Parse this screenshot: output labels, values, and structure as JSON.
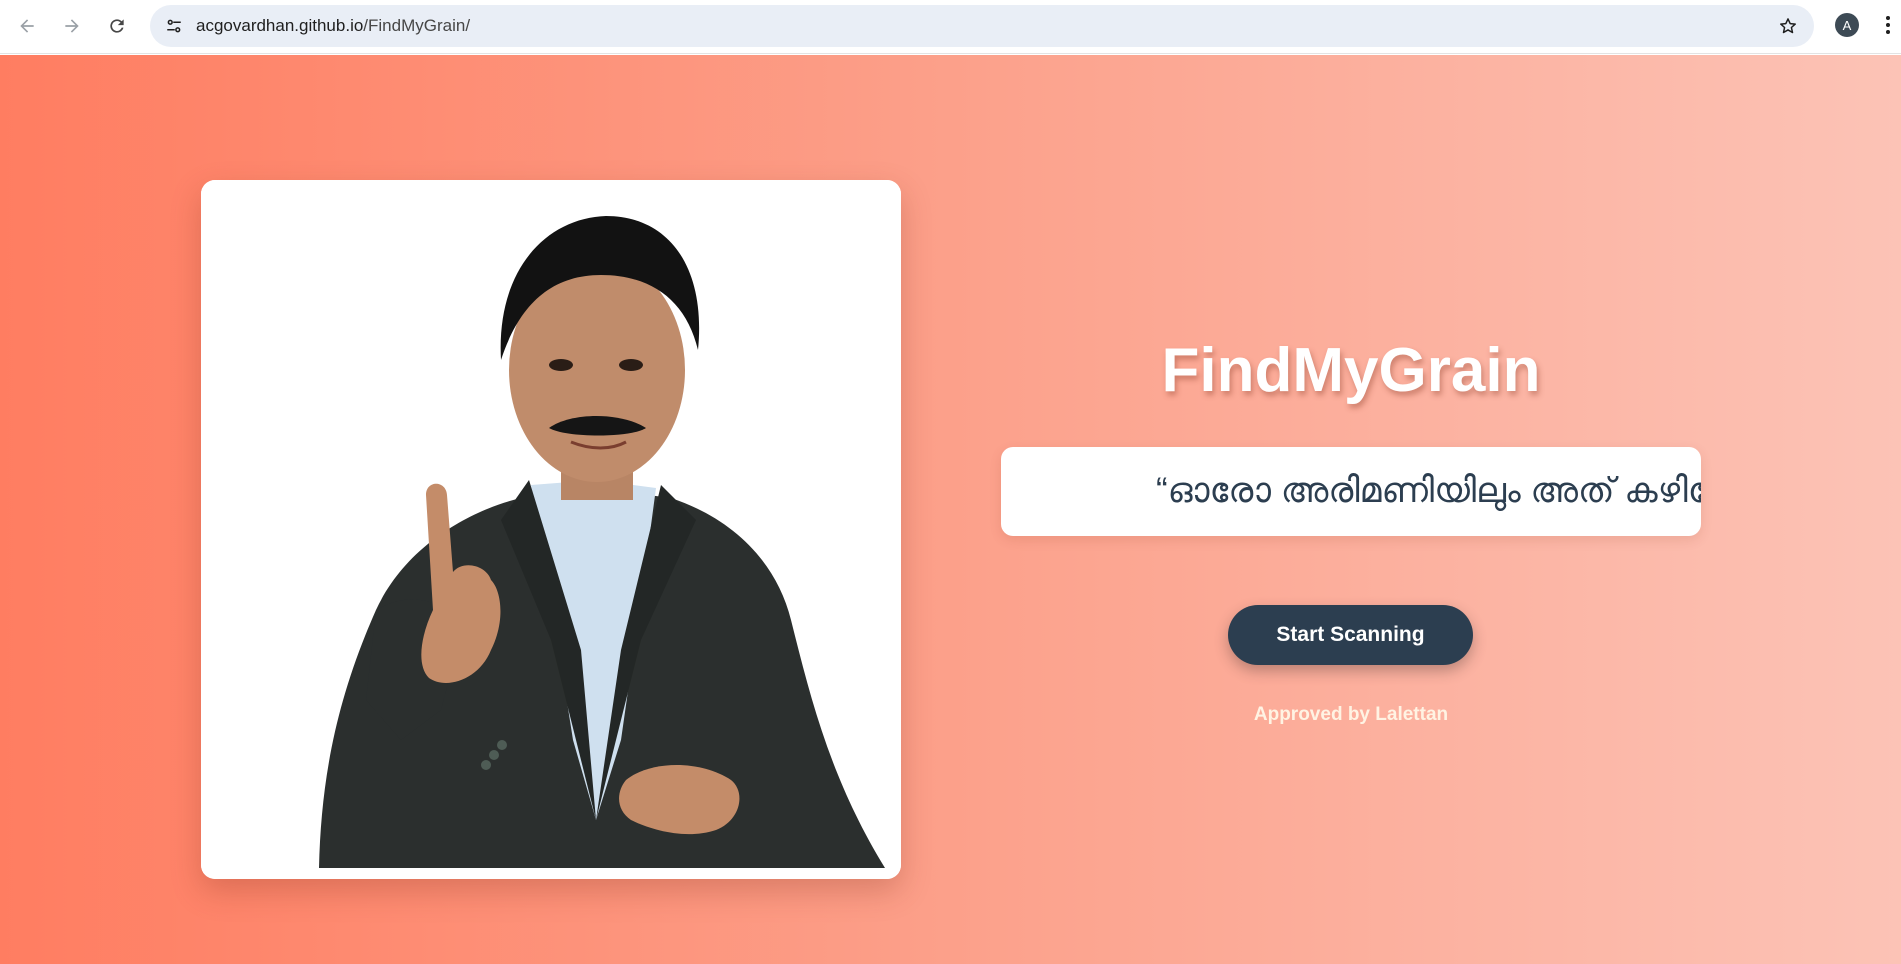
{
  "browser": {
    "url_host": "acgovardhan.github.io",
    "url_path": "/FindMyGrain/",
    "profile_initial": "A",
    "icons": [
      "back-icon",
      "forward-icon",
      "reload-icon",
      "site-info-icon",
      "bookmark-star-icon",
      "more-menu-icon"
    ]
  },
  "page": {
    "title": "FindMyGrain",
    "quote": "“ഓരോ അരിമണിയിലും അത് കഴിക്കേണ്ടവന്റെ പേരുണ്ട്”",
    "start_button_label": "Start Scanning",
    "approved_text": "Approved by Lalettan",
    "image_alt": "Man in dark suit raising index finger",
    "colors": {
      "gradient_start": "#ff7d61",
      "gradient_end": "#fcc3b6",
      "button_bg": "#2c3e50",
      "quote_text": "#2c3e50",
      "title_text": "#ffffff"
    }
  }
}
